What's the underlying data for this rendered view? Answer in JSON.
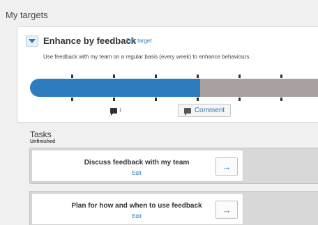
{
  "page": {
    "title": "My targets"
  },
  "target": {
    "expand_icon": "chevron-down-icon",
    "title": "Enhance by feedback",
    "edit_label": "Edit target",
    "description": "Use feedback with my team on a regular basis (every week) to enhance behaviours.",
    "progress": 0.575,
    "comment_count": "1",
    "comment_button_label": "Comment"
  },
  "colors": {
    "accent": "#2e7cc0",
    "track": "#a9a0a0",
    "link": "#2f78b7"
  },
  "tasks": {
    "title": "Tasks",
    "subtitle": "Unfinished",
    "items": [
      {
        "name": "Discuss feedback with my team",
        "edit_label": "Edit",
        "action_icon": "arrow-right-icon",
        "action_glyph": "→"
      },
      {
        "name": "Plan for how and when to use feedback",
        "edit_label": "Edit",
        "action_icon": "arrow-right-icon",
        "action_glyph": "→"
      }
    ]
  }
}
